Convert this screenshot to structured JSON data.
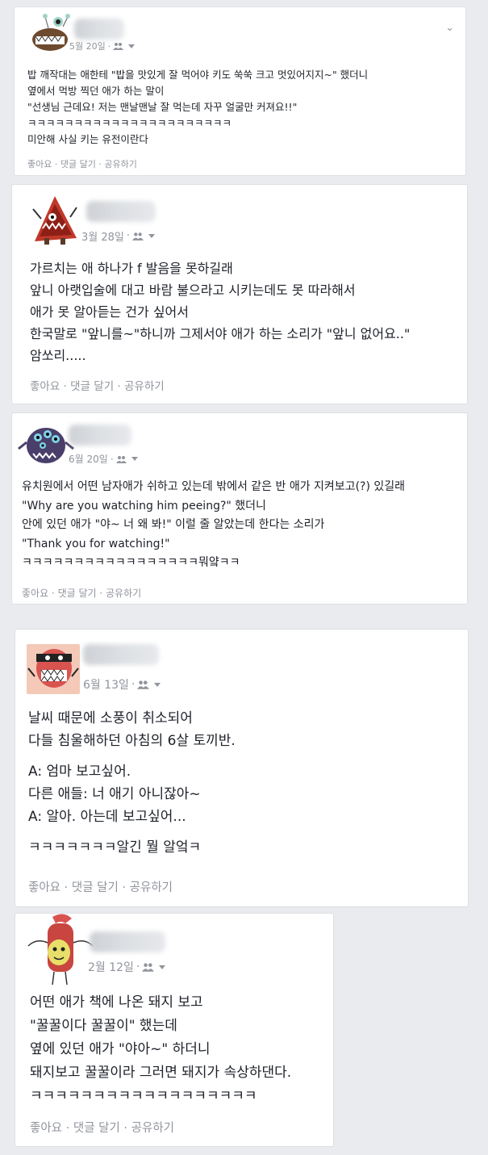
{
  "posts": [
    {
      "date": "5월 20일",
      "lines": [
        "밥 깨작대는 애한테 \"밥을 맛있게 잘 먹어야 키도 쑥쑥 크고 멋있어지지~\" 했더니",
        "옆에서 먹방 찍던 애가 하는 말이",
        "\"선생님 근데요! 저는 맨날맨날 잘 먹는데 자꾸 얼굴만 커져요!!\"",
        "ㅋㅋㅋㅋㅋㅋㅋㅋㅋㅋㅋㅋㅋㅋㅋㅋㅋㅋㅋㅋㅋㅋ",
        "미안해 사실 키는 유전이란다"
      ],
      "actions": {
        "like": "좋아요",
        "comment": "댓글 달기",
        "share": "공유하기"
      },
      "avatar_icon": "monster-avatar-icon"
    },
    {
      "date": "3월 28일",
      "lines": [
        "가르치는 애 하나가 f 발음을 못하길래",
        "앞니 아랫입술에 대고 바람 불으라고 시키는데도 못 따라해서",
        "애가 못 알아듣는 건가 싶어서",
        "한국말로 \"앞니를~\"하니까 그제서야 애가 하는 소리가 \"앞니 없어요..\"",
        "암쏘리....."
      ],
      "actions": {
        "like": "좋아요",
        "comment": "댓글 달기",
        "share": "공유하기"
      },
      "avatar_icon": "monster-avatar-icon"
    },
    {
      "date": "6월 20일",
      "lines": [
        "유치원에서 어떤 남자애가 쉬하고 있는데 밖에서 같은 반 애가 지켜보고(?) 있길래",
        "\"Why are you watching him peeing?\" 했더니",
        "안에 있던 애가 \"야~ 너 왜 봐!\" 이럴 줄 알았는데 한다는 소리가",
        "\"Thank you for watching!\"",
        "ㅋㅋㅋㅋㅋㅋㅋㅋㅋㅋㅋㅋㅋㅋㅋㅋㅋ뭐얔ㅋㅋ"
      ],
      "actions": {
        "like": "좋아요",
        "comment": "댓글 달기",
        "share": "공유하기"
      },
      "avatar_icon": "monster-avatar-icon"
    },
    {
      "date": "6월 13일",
      "lines": [
        "날씨 때문에 소풍이 취소되어",
        "다들 침울해하던 아침의 6살 토끼반.",
        "",
        "A: 엄마 보고싶어.",
        "다른 애들: 너 애기 아니잖아~",
        "A: 알아. 아는데 보고싶어...",
        "",
        "ㅋㅋㅋㅋㅋㅋㅋ알긴 뭘 알엌ㅋ"
      ],
      "actions": {
        "like": "좋아요",
        "comment": "댓글 달기",
        "share": "공유하기"
      },
      "avatar_icon": "monster-avatar-icon"
    },
    {
      "date": "2월 12일",
      "lines": [
        "어떤 애가 책에 나온 돼지 보고",
        "\"꿀꿀이다 꿀꿀이\" 했는데",
        "옆에 있던 애가 \"야아~\" 하더니",
        "돼지보고 꿀꿀이라 그러면 돼지가 속상하댄다.",
        "ㅋㅋㅋㅋㅋㅋㅋㅋㅋㅋㅋㅋㅋㅋㅋㅋㅋㅋ"
      ],
      "actions": {
        "like": "좋아요",
        "comment": "댓글 달기",
        "share": "공유하기"
      },
      "avatar_icon": "monster-avatar-icon"
    }
  ],
  "icons": {
    "privacy": "friends-icon",
    "menu": "chevron-down-icon"
  },
  "separator": " · "
}
